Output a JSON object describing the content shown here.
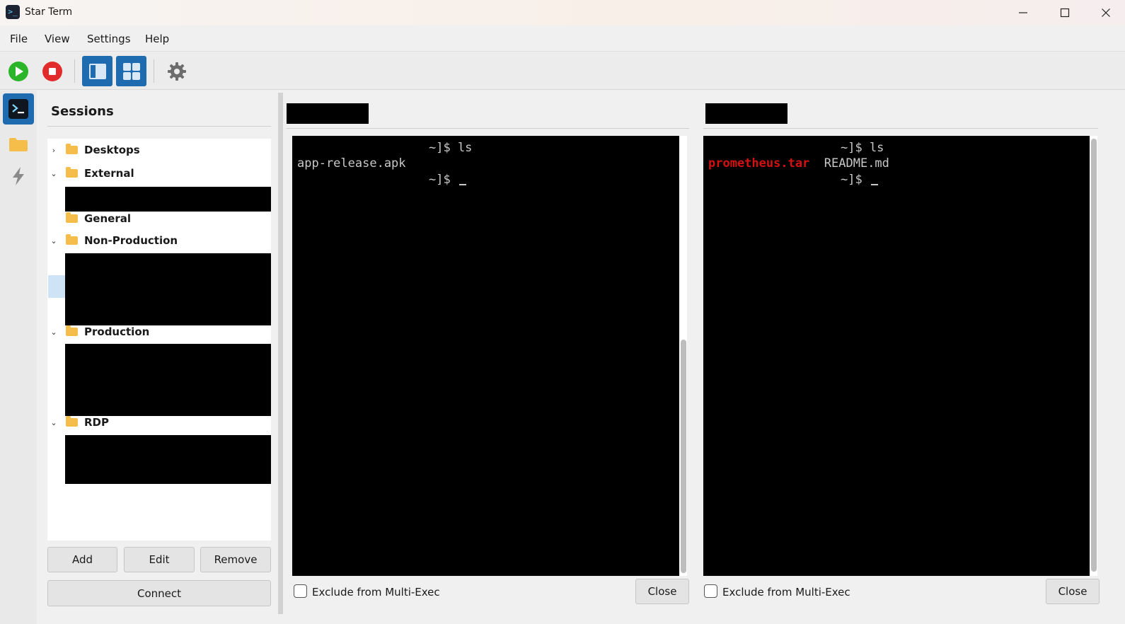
{
  "window": {
    "title": "Star Term",
    "app_icon": "terminal-icon"
  },
  "menu": {
    "file": "File",
    "view": "View",
    "settings": "Settings",
    "help": "Help"
  },
  "toolbar": {
    "icons": [
      "play-icon",
      "stop-icon",
      "sidebar-layout-icon",
      "grid-layout-icon",
      "gear-icon"
    ],
    "colors": {
      "play": "#2ab52a",
      "stop": "#e22b2b",
      "active": "#1f6bb0"
    }
  },
  "activity_bar": {
    "icons": [
      "terminal-icon",
      "folder-icon",
      "lightning-icon"
    ]
  },
  "sessions": {
    "title": "Sessions",
    "groups": [
      {
        "label": "Desktops",
        "expanded": false
      },
      {
        "label": "External",
        "expanded": true
      },
      {
        "label": "General",
        "expanded": false
      },
      {
        "label": "Non-Production",
        "expanded": true
      },
      {
        "label": "Production",
        "expanded": true
      },
      {
        "label": "RDP",
        "expanded": true
      }
    ],
    "buttons": {
      "add": "Add",
      "edit": "Edit",
      "remove": "Remove",
      "connect": "Connect"
    }
  },
  "terminals": [
    {
      "lines": [
        {
          "text": "~]$ ls"
        },
        {
          "text": "app-release.apk"
        },
        {
          "text": "~]$ "
        }
      ],
      "exclude_label": "Exclude from Multi-Exec",
      "close_label": "Close"
    },
    {
      "lines": [
        {
          "text": "~]$ ls"
        },
        {
          "text_red": "prometheus.tar",
          "text": "README.md"
        },
        {
          "text": "~]$ "
        }
      ],
      "exclude_label": "Exclude from Multi-Exec",
      "close_label": "Close"
    }
  ],
  "colors": {
    "terminal_bg": "#000000",
    "terminal_fg": "#c8c8c8",
    "highlight_red": "#d41111",
    "folder": "#f5be4a"
  }
}
